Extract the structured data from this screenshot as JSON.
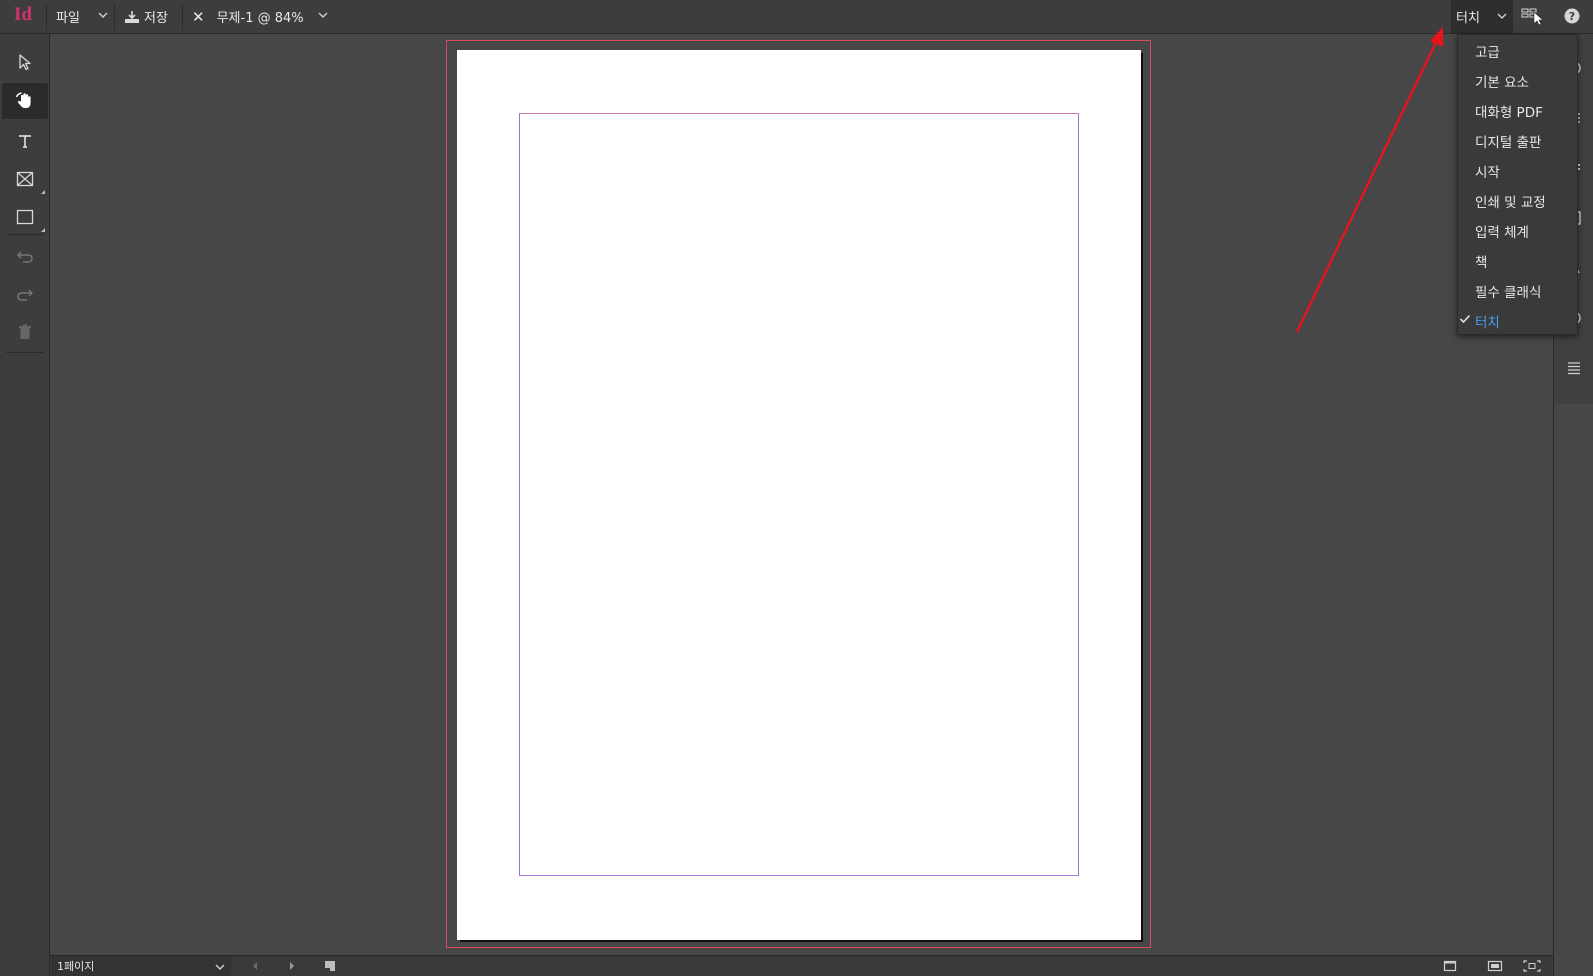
{
  "app": {
    "logo": "Id"
  },
  "topbar": {
    "file_label": "파일",
    "save_label": "저장",
    "document_tab": "무제-1 @ 84%",
    "workspace_current": "터치"
  },
  "workspace_menu": {
    "items": [
      {
        "label": "고급",
        "selected": false
      },
      {
        "label": "기본 요소",
        "selected": false
      },
      {
        "label": "대화형 PDF",
        "selected": false
      },
      {
        "label": "디지털 출판",
        "selected": false
      },
      {
        "label": "시작",
        "selected": false
      },
      {
        "label": "인쇄 및 교정",
        "selected": false
      },
      {
        "label": "입력 체계",
        "selected": false
      },
      {
        "label": "책",
        "selected": false
      },
      {
        "label": "필수 클래식",
        "selected": false
      },
      {
        "label": "터치",
        "selected": true
      }
    ]
  },
  "toolbar": {
    "tools": [
      "selection-tool",
      "hand-tool",
      "type-tool",
      "rectangle-frame-tool",
      "rectangle-tool",
      "undo",
      "redo",
      "delete"
    ],
    "active_tool": "hand-tool"
  },
  "statusbar": {
    "page_label": "1페이지"
  },
  "colors": {
    "accent_selected": "#4a9cf0",
    "bleed_guide": "#d64a64",
    "margin_guide": "#8b78e0",
    "annotation_arrow": "#e8141c",
    "logo": "#d1336e"
  }
}
